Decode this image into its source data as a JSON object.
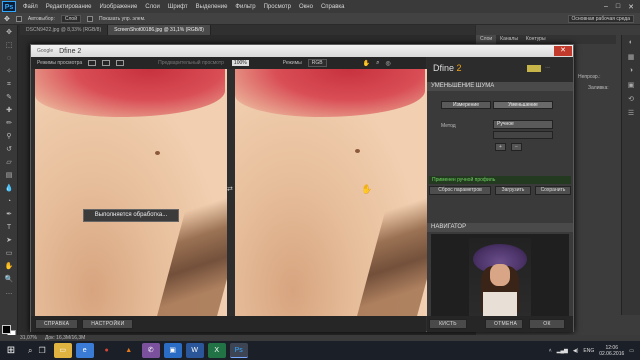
{
  "ps": {
    "menu": [
      "Файл",
      "Редактирование",
      "Изображение",
      "Слои",
      "Шрифт",
      "Выделение",
      "Фильтр",
      "Просмотр",
      "Окно",
      "Справка"
    ],
    "logo": "Ps",
    "options": {
      "auto_select": "Автовыбор:",
      "layer_value": "Слой",
      "show_controls": "Показать упр. элем.",
      "workspace": "Основная рабочая среда"
    },
    "tabs": [
      "DSCN9422.jpg @ 8,33% (RGB/8)",
      "ScreenShot00186.jpg @ 31,1% (RGB/8)"
    ],
    "right_tabs": [
      "Слои",
      "Каналы",
      "Контуры"
    ],
    "right_labels": {
      "opacity": "Непрозр.:",
      "fill": "Заливка:"
    },
    "status": {
      "zoom": "31,07%",
      "doc": "Док: 16,3M/16,3M"
    }
  },
  "dfine": {
    "google": "Google",
    "title": "Dfine 2",
    "close": "✕",
    "preview_mode": "Режимы просмотра",
    "loupe": "Предварительный просмотр",
    "zoom": "100%",
    "right_mode_label": "Режимы",
    "right_mode_value": "RGB",
    "processing": "Выполняется обработка...",
    "brand_name": "Dfine",
    "brand_num": "2",
    "section_reduce": "УМЕНЬШЕНИЕ ШУМА",
    "seg_measure": "Измерение",
    "seg_reduce": "Уменьшение",
    "method_label": "Метод",
    "method_value": "Ручное",
    "profile_msg": "Применен ручной профиль",
    "btn_reset": "Сброс параметров",
    "btn_load": "Загрузить",
    "btn_save": "Сохранить",
    "section_nav": "НАВИГАТОР",
    "btn_help": "СПРАВКА",
    "btn_settings": "НАСТРОЙКИ",
    "btn_brush": "КИСТЬ",
    "btn_cancel": "ОТМЕНА",
    "btn_ok": "ОК"
  },
  "taskbar": {
    "start": "⊞",
    "apps": [
      {
        "name": "file-explorer",
        "glyph": "▭",
        "color": "#e0b341"
      },
      {
        "name": "edge",
        "glyph": "e",
        "color": "#3a7bd5"
      },
      {
        "name": "chrome",
        "glyph": "●",
        "color": "#d64534"
      },
      {
        "name": "vlc",
        "glyph": "▲",
        "color": "#e8791a"
      },
      {
        "name": "viber",
        "glyph": "✆",
        "color": "#7b519d"
      },
      {
        "name": "store",
        "glyph": "▣",
        "color": "#2b6cc4"
      },
      {
        "name": "word",
        "glyph": "W",
        "color": "#2b579a"
      },
      {
        "name": "excel",
        "glyph": "X",
        "color": "#217346"
      },
      {
        "name": "photoshop",
        "glyph": "Ps",
        "color": "#31a8ff"
      }
    ],
    "lang": "ENG",
    "time": "12:06",
    "date": "02.06.2016"
  }
}
